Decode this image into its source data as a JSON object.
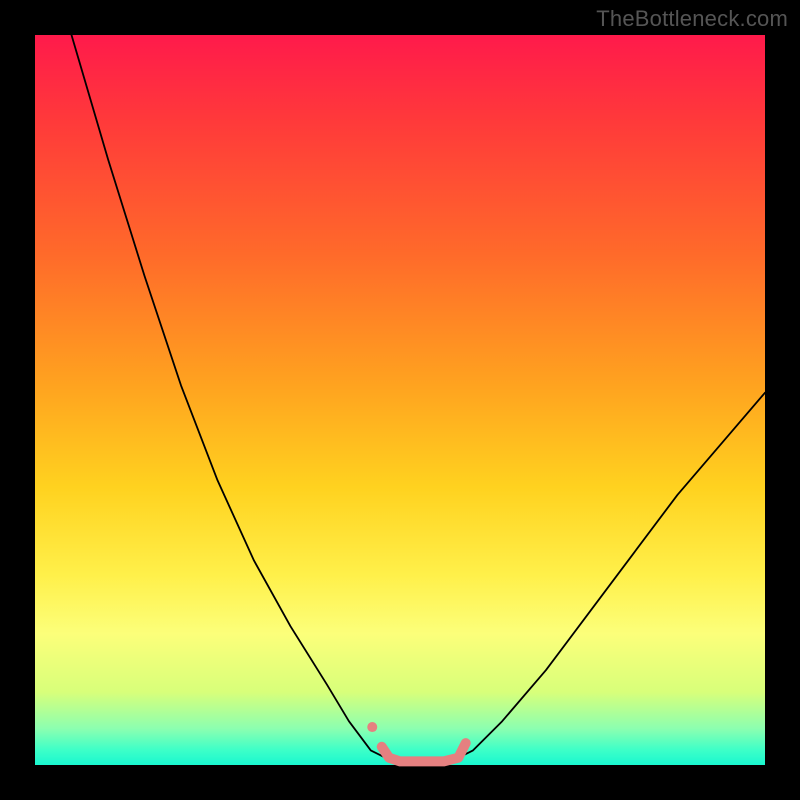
{
  "watermark": "TheBottleneck.com",
  "chart_data": {
    "type": "line",
    "title": "",
    "xlabel": "",
    "ylabel": "",
    "xlim": [
      0,
      100
    ],
    "ylim": [
      0,
      100
    ],
    "gradient_stops": [
      {
        "pos": 0,
        "color": "#ff1a4b"
      },
      {
        "pos": 12,
        "color": "#ff3a3a"
      },
      {
        "pos": 30,
        "color": "#ff6a2a"
      },
      {
        "pos": 48,
        "color": "#ffa31f"
      },
      {
        "pos": 62,
        "color": "#ffd21f"
      },
      {
        "pos": 74,
        "color": "#fff04a"
      },
      {
        "pos": 82,
        "color": "#fcff7a"
      },
      {
        "pos": 90,
        "color": "#d8ff7a"
      },
      {
        "pos": 95,
        "color": "#8cffb0"
      },
      {
        "pos": 98,
        "color": "#3cffc8"
      },
      {
        "pos": 100,
        "color": "#19f7d0"
      }
    ],
    "series": [
      {
        "name": "left-curve",
        "color": "#000000",
        "width": 1.8,
        "points": [
          {
            "x": 5.0,
            "y": 100.0
          },
          {
            "x": 10.0,
            "y": 83.0
          },
          {
            "x": 15.0,
            "y": 67.0
          },
          {
            "x": 20.0,
            "y": 52.0
          },
          {
            "x": 25.0,
            "y": 39.0
          },
          {
            "x": 30.0,
            "y": 28.0
          },
          {
            "x": 35.0,
            "y": 19.0
          },
          {
            "x": 40.0,
            "y": 11.0
          },
          {
            "x": 43.0,
            "y": 6.0
          },
          {
            "x": 46.0,
            "y": 2.0
          },
          {
            "x": 48.0,
            "y": 1.0
          }
        ]
      },
      {
        "name": "right-curve",
        "color": "#000000",
        "width": 1.8,
        "points": [
          {
            "x": 58.0,
            "y": 1.0
          },
          {
            "x": 60.0,
            "y": 2.0
          },
          {
            "x": 64.0,
            "y": 6.0
          },
          {
            "x": 70.0,
            "y": 13.0
          },
          {
            "x": 76.0,
            "y": 21.0
          },
          {
            "x": 82.0,
            "y": 29.0
          },
          {
            "x": 88.0,
            "y": 37.0
          },
          {
            "x": 94.0,
            "y": 44.0
          },
          {
            "x": 100.0,
            "y": 51.0
          }
        ]
      },
      {
        "name": "pink-bottom",
        "color": "#e58080",
        "width": 10,
        "points": [
          {
            "x": 47.5,
            "y": 2.5
          },
          {
            "x": 48.5,
            "y": 1.0
          },
          {
            "x": 50.0,
            "y": 0.5
          },
          {
            "x": 53.0,
            "y": 0.5
          },
          {
            "x": 56.0,
            "y": 0.5
          },
          {
            "x": 58.0,
            "y": 1.0
          },
          {
            "x": 59.0,
            "y": 3.0
          }
        ]
      }
    ],
    "markers": [
      {
        "name": "pink-dot",
        "x": 46.2,
        "y": 5.2,
        "r": 5,
        "color": "#e58080"
      }
    ]
  }
}
